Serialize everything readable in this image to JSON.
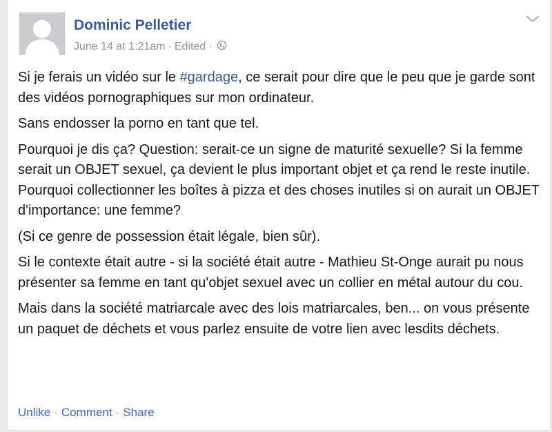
{
  "post": {
    "author": "Dominic Pelletier",
    "timestamp": "June 14 at 1:21am",
    "edited_label": "Edited",
    "separator": "·",
    "privacy_icon": "globe-icon",
    "menu_icon": "chevron-down-icon",
    "paragraphs": [
      {
        "before": "Si je ferais un vidéo sur le ",
        "hashtag": "#gardage",
        "after": ", ce serait pour dire que le peu que je garde sont des vidéos pornographiques sur mon ordinateur."
      },
      {
        "text": "Sans endosser la porno en tant que tel."
      },
      {
        "text": "Pourquoi je dis ça? Question: serait-ce un signe de maturité sexuelle? Si la femme serait un OBJET sexuel, ça devient le plus important objet et ça rend le reste inutile. Pourquoi collectionner les boîtes à pizza et des choses inutiles si on aurait un OBJET d'importance: une femme?"
      },
      {
        "text": "(Si ce genre de possession était légale, bien sûr)."
      },
      {
        "text": "Si le contexte était autre - si la société était autre - Mathieu St-Onge aurait pu nous présenter sa femme en tant qu'objet sexuel avec un collier en métal autour du cou."
      },
      {
        "text": "Mais dans la société matriarcale avec des lois matriarcales, ben... on vous présente un paquet de déchets et vous parlez ensuite de votre lien avec lesdits déchets."
      }
    ],
    "actions": {
      "unlike": "Unlike",
      "comment": "Comment",
      "share": "Share",
      "separator": "·"
    }
  },
  "colors": {
    "link_blue": "#3b5998",
    "meta_gray": "#90949c",
    "text": "#141823"
  }
}
